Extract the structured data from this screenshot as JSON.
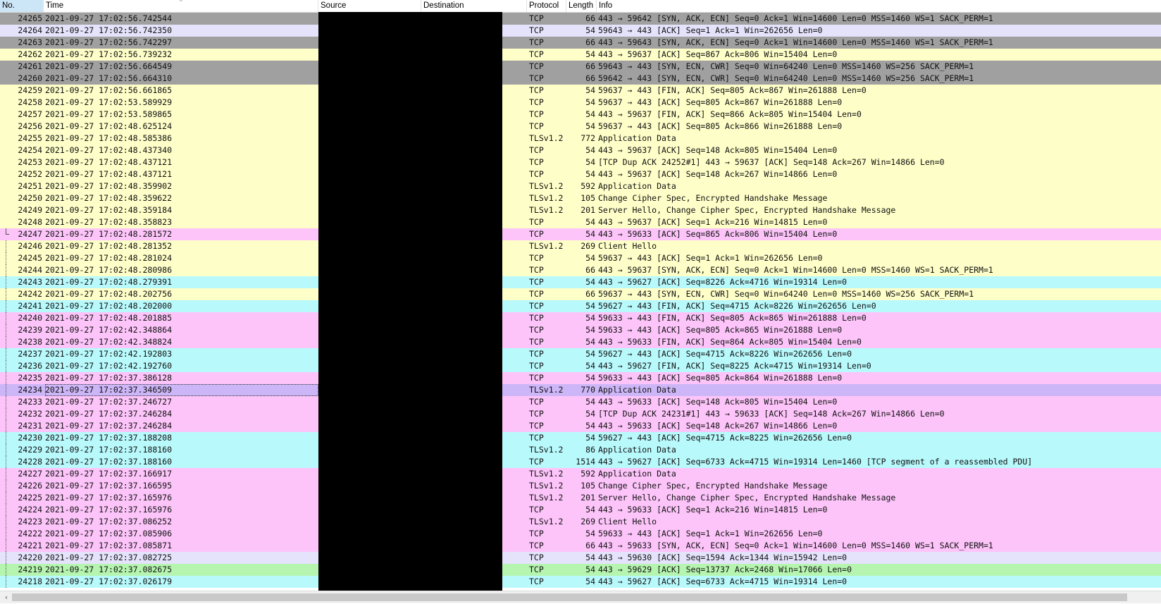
{
  "columns": {
    "no": "No.",
    "time": "Time",
    "source": "Source",
    "destination": "Destination",
    "protocol": "Protocol",
    "length": "Length",
    "info": "Info"
  },
  "colors": {
    "gray": "#a0a0a0",
    "lavender": "#e5e2fb",
    "yellow": "#fefec8",
    "pink": "#fcc4f9",
    "cyan": "#b8f9fc",
    "purple": "#cdb6f7",
    "green": "#b6f5b0"
  },
  "packets": [
    {
      "no": "24265",
      "time": "2021-09-27 17:02:56.742544",
      "protocol": "TCP",
      "length": "66",
      "info": "443 → 59642 [SYN, ACK, ECN] Seq=0 Ack=1 Win=14600 Len=0 MSS=1460 WS=1 SACK_PERM=1",
      "color": "gray"
    },
    {
      "no": "24264",
      "time": "2021-09-27 17:02:56.742350",
      "protocol": "TCP",
      "length": "54",
      "info": "59643 → 443 [ACK] Seq=1 Ack=1 Win=262656 Len=0",
      "color": "lavender"
    },
    {
      "no": "24263",
      "time": "2021-09-27 17:02:56.742297",
      "protocol": "TCP",
      "length": "66",
      "info": "443 → 59643 [SYN, ACK, ECN] Seq=0 Ack=1 Win=14600 Len=0 MSS=1460 WS=1 SACK_PERM=1",
      "color": "gray"
    },
    {
      "no": "24262",
      "time": "2021-09-27 17:02:56.739232",
      "protocol": "TCP",
      "length": "54",
      "info": "443 → 59637 [ACK] Seq=867 Ack=806 Win=15404 Len=0",
      "color": "yellow"
    },
    {
      "no": "24261",
      "time": "2021-09-27 17:02:56.664549",
      "protocol": "TCP",
      "length": "66",
      "info": "59643 → 443 [SYN, ECN, CWR] Seq=0 Win=64240 Len=0 MSS=1460 WS=256 SACK_PERM=1",
      "color": "gray"
    },
    {
      "no": "24260",
      "time": "2021-09-27 17:02:56.664310",
      "protocol": "TCP",
      "length": "66",
      "info": "59642 → 443 [SYN, ECN, CWR] Seq=0 Win=64240 Len=0 MSS=1460 WS=256 SACK_PERM=1",
      "color": "gray"
    },
    {
      "no": "24259",
      "time": "2021-09-27 17:02:56.661865",
      "protocol": "TCP",
      "length": "54",
      "info": "59637 → 443 [FIN, ACK] Seq=805 Ack=867 Win=261888 Len=0",
      "color": "yellow"
    },
    {
      "no": "24258",
      "time": "2021-09-27 17:02:53.589929",
      "protocol": "TCP",
      "length": "54",
      "info": "59637 → 443 [ACK] Seq=805 Ack=867 Win=261888 Len=0",
      "color": "yellow"
    },
    {
      "no": "24257",
      "time": "2021-09-27 17:02:53.589865",
      "protocol": "TCP",
      "length": "54",
      "info": "443 → 59637 [FIN, ACK] Seq=866 Ack=805 Win=15404 Len=0",
      "color": "yellow"
    },
    {
      "no": "24256",
      "time": "2021-09-27 17:02:48.625124",
      "protocol": "TCP",
      "length": "54",
      "info": "59637 → 443 [ACK] Seq=805 Ack=866 Win=261888 Len=0",
      "color": "yellow"
    },
    {
      "no": "24255",
      "time": "2021-09-27 17:02:48.585386",
      "protocol": "TLSv1.2",
      "length": "772",
      "info": "Application Data",
      "color": "yellow"
    },
    {
      "no": "24254",
      "time": "2021-09-27 17:02:48.437340",
      "protocol": "TCP",
      "length": "54",
      "info": "443 → 59637 [ACK] Seq=148 Ack=805 Win=15404 Len=0",
      "color": "yellow"
    },
    {
      "no": "24253",
      "time": "2021-09-27 17:02:48.437121",
      "protocol": "TCP",
      "length": "54",
      "info": "[TCP Dup ACK 24252#1] 443 → 59637 [ACK] Seq=148 Ack=267 Win=14866 Len=0",
      "color": "yellow"
    },
    {
      "no": "24252",
      "time": "2021-09-27 17:02:48.437121",
      "protocol": "TCP",
      "length": "54",
      "info": "443 → 59637 [ACK] Seq=148 Ack=267 Win=14866 Len=0",
      "color": "yellow"
    },
    {
      "no": "24251",
      "time": "2021-09-27 17:02:48.359902",
      "protocol": "TLSv1.2",
      "length": "592",
      "info": "Application Data",
      "color": "yellow"
    },
    {
      "no": "24250",
      "time": "2021-09-27 17:02:48.359622",
      "protocol": "TLSv1.2",
      "length": "105",
      "info": "Change Cipher Spec, Encrypted Handshake Message",
      "color": "yellow"
    },
    {
      "no": "24249",
      "time": "2021-09-27 17:02:48.359184",
      "protocol": "TLSv1.2",
      "length": "201",
      "info": "Server Hello, Change Cipher Spec, Encrypted Handshake Message",
      "color": "yellow"
    },
    {
      "no": "24248",
      "time": "2021-09-27 17:02:48.358823",
      "protocol": "TCP",
      "length": "54",
      "info": "443 → 59637 [ACK] Seq=1 Ack=216 Win=14815 Len=0",
      "color": "yellow"
    },
    {
      "no": "24247",
      "time": "2021-09-27 17:02:48.281572",
      "protocol": "TCP",
      "length": "54",
      "info": "443 → 59633 [ACK] Seq=865 Ack=806 Win=15404 Len=0",
      "color": "pink",
      "conv": "end"
    },
    {
      "no": "24246",
      "time": "2021-09-27 17:02:48.281352",
      "protocol": "TLSv1.2",
      "length": "269",
      "info": "Client Hello",
      "color": "yellow",
      "conv": "line"
    },
    {
      "no": "24245",
      "time": "2021-09-27 17:02:48.281024",
      "protocol": "TCP",
      "length": "54",
      "info": "59637 → 443 [ACK] Seq=1 Ack=1 Win=262656 Len=0",
      "color": "yellow",
      "conv": "line"
    },
    {
      "no": "24244",
      "time": "2021-09-27 17:02:48.280986",
      "protocol": "TCP",
      "length": "66",
      "info": "443 → 59637 [SYN, ACK, ECN] Seq=0 Ack=1 Win=14600 Len=0 MSS=1460 WS=1 SACK_PERM=1",
      "color": "yellow",
      "conv": "line"
    },
    {
      "no": "24243",
      "time": "2021-09-27 17:02:48.279391",
      "protocol": "TCP",
      "length": "54",
      "info": "443 → 59627 [ACK] Seq=8226 Ack=4716 Win=19314 Len=0",
      "color": "cyan",
      "conv": "line"
    },
    {
      "no": "24242",
      "time": "2021-09-27 17:02:48.202756",
      "protocol": "TCP",
      "length": "66",
      "info": "59637 → 443 [SYN, ECN, CWR] Seq=0 Win=64240 Len=0 MSS=1460 WS=256 SACK_PERM=1",
      "color": "yellow",
      "conv": "line"
    },
    {
      "no": "24241",
      "time": "2021-09-27 17:02:48.202000",
      "protocol": "TCP",
      "length": "54",
      "info": "59627 → 443 [FIN, ACK] Seq=4715 Ack=8226 Win=262656 Len=0",
      "color": "cyan",
      "conv": "line"
    },
    {
      "no": "24240",
      "time": "2021-09-27 17:02:48.201885",
      "protocol": "TCP",
      "length": "54",
      "info": "59633 → 443 [FIN, ACK] Seq=805 Ack=865 Win=261888 Len=0",
      "color": "pink",
      "conv": "line"
    },
    {
      "no": "24239",
      "time": "2021-09-27 17:02:42.348864",
      "protocol": "TCP",
      "length": "54",
      "info": "59633 → 443 [ACK] Seq=805 Ack=865 Win=261888 Len=0",
      "color": "pink",
      "conv": "line"
    },
    {
      "no": "24238",
      "time": "2021-09-27 17:02:42.348824",
      "protocol": "TCP",
      "length": "54",
      "info": "443 → 59633 [FIN, ACK] Seq=864 Ack=805 Win=15404 Len=0",
      "color": "pink",
      "conv": "line"
    },
    {
      "no": "24237",
      "time": "2021-09-27 17:02:42.192803",
      "protocol": "TCP",
      "length": "54",
      "info": "59627 → 443 [ACK] Seq=4715 Ack=8226 Win=262656 Len=0",
      "color": "cyan",
      "conv": "line"
    },
    {
      "no": "24236",
      "time": "2021-09-27 17:02:42.192760",
      "protocol": "TCP",
      "length": "54",
      "info": "443 → 59627 [FIN, ACK] Seq=8225 Ack=4715 Win=19314 Len=0",
      "color": "cyan",
      "conv": "line"
    },
    {
      "no": "24235",
      "time": "2021-09-27 17:02:37.386128",
      "protocol": "TCP",
      "length": "54",
      "info": "59633 → 443 [ACK] Seq=805 Ack=864 Win=261888 Len=0",
      "color": "pink",
      "conv": "line"
    },
    {
      "no": "24234",
      "time": "2021-09-27 17:02:37.346509",
      "protocol": "TLSv1.2",
      "length": "770",
      "info": "Application Data",
      "color": "purple",
      "conv": "line",
      "selected": true
    },
    {
      "no": "24233",
      "time": "2021-09-27 17:02:37.246727",
      "protocol": "TCP",
      "length": "54",
      "info": "443 → 59633 [ACK] Seq=148 Ack=805 Win=15404 Len=0",
      "color": "pink",
      "conv": "line"
    },
    {
      "no": "24232",
      "time": "2021-09-27 17:02:37.246284",
      "protocol": "TCP",
      "length": "54",
      "info": "[TCP Dup ACK 24231#1] 443 → 59633 [ACK] Seq=148 Ack=267 Win=14866 Len=0",
      "color": "pink",
      "conv": "line"
    },
    {
      "no": "24231",
      "time": "2021-09-27 17:02:37.246284",
      "protocol": "TCP",
      "length": "54",
      "info": "443 → 59633 [ACK] Seq=148 Ack=267 Win=14866 Len=0",
      "color": "pink",
      "conv": "line"
    },
    {
      "no": "24230",
      "time": "2021-09-27 17:02:37.188208",
      "protocol": "TCP",
      "length": "54",
      "info": "59627 → 443 [ACK] Seq=4715 Ack=8225 Win=262656 Len=0",
      "color": "cyan",
      "conv": "line"
    },
    {
      "no": "24229",
      "time": "2021-09-27 17:02:37.188160",
      "protocol": "TLSv1.2",
      "length": "86",
      "info": "Application Data",
      "color": "cyan",
      "conv": "line"
    },
    {
      "no": "24228",
      "time": "2021-09-27 17:02:37.188160",
      "protocol": "TCP",
      "length": "1514",
      "info": "443 → 59627 [ACK] Seq=6733 Ack=4715 Win=19314 Len=1460 [TCP segment of a reassembled PDU]",
      "color": "cyan",
      "conv": "line"
    },
    {
      "no": "24227",
      "time": "2021-09-27 17:02:37.166917",
      "protocol": "TLSv1.2",
      "length": "592",
      "info": "Application Data",
      "color": "pink",
      "conv": "line"
    },
    {
      "no": "24226",
      "time": "2021-09-27 17:02:37.166595",
      "protocol": "TLSv1.2",
      "length": "105",
      "info": "Change Cipher Spec, Encrypted Handshake Message",
      "color": "pink",
      "conv": "line"
    },
    {
      "no": "24225",
      "time": "2021-09-27 17:02:37.165976",
      "protocol": "TLSv1.2",
      "length": "201",
      "info": "Server Hello, Change Cipher Spec, Encrypted Handshake Message",
      "color": "pink",
      "conv": "line"
    },
    {
      "no": "24224",
      "time": "2021-09-27 17:02:37.165976",
      "protocol": "TCP",
      "length": "54",
      "info": "443 → 59633 [ACK] Seq=1 Ack=216 Win=14815 Len=0",
      "color": "pink",
      "conv": "line"
    },
    {
      "no": "24223",
      "time": "2021-09-27 17:02:37.086252",
      "protocol": "TLSv1.2",
      "length": "269",
      "info": "Client Hello",
      "color": "pink",
      "conv": "line"
    },
    {
      "no": "24222",
      "time": "2021-09-27 17:02:37.085906",
      "protocol": "TCP",
      "length": "54",
      "info": "59633 → 443 [ACK] Seq=1 Ack=1 Win=262656 Len=0",
      "color": "pink",
      "conv": "line"
    },
    {
      "no": "24221",
      "time": "2021-09-27 17:02:37.085871",
      "protocol": "TCP",
      "length": "66",
      "info": "443 → 59633 [SYN, ACK, ECN] Seq=0 Ack=1 Win=14600 Len=0 MSS=1460 WS=1 SACK_PERM=1",
      "color": "pink",
      "conv": "line"
    },
    {
      "no": "24220",
      "time": "2021-09-27 17:02:37.082725",
      "protocol": "TCP",
      "length": "54",
      "info": "443 → 59630 [ACK] Seq=1594 Ack=1344 Win=15942 Len=0",
      "color": "lavender",
      "conv": "line"
    },
    {
      "no": "24219",
      "time": "2021-09-27 17:02:37.082675",
      "protocol": "TCP",
      "length": "54",
      "info": "443 → 59629 [ACK] Seq=13737 Ack=2468 Win=17066 Len=0",
      "color": "green",
      "conv": "line"
    },
    {
      "no": "24218",
      "time": "2021-09-27 17:02:37.026179",
      "protocol": "TCP",
      "length": "54",
      "info": "443 → 59627 [ACK] Seq=6733 Ack=4715 Win=19314 Len=0",
      "color": "cyan",
      "conv": "line"
    }
  ],
  "scrollbar": {
    "left_arrow_icon": "‹"
  }
}
